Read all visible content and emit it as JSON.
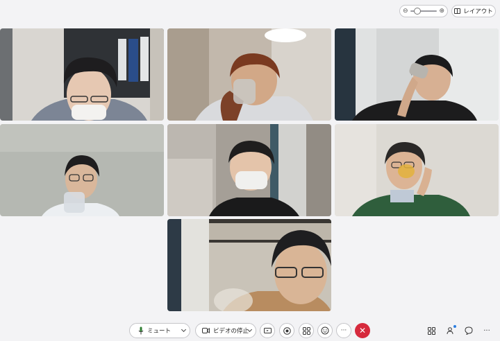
{
  "header": {
    "zoom_minus_icon": "zoom-out-icon",
    "zoom_plus_icon": "zoom-in-icon",
    "zoom_level": 0.2,
    "layout_label": "レイアウト"
  },
  "controls": {
    "mute_label": "ミュート",
    "video_stop_label": "ビデオの停止",
    "more_label": "···",
    "end_icon": "✕"
  },
  "colors": {
    "end_call": "#d62a3d",
    "notification_dot": "#2a7de1"
  },
  "participants": [
    {
      "id": "p1",
      "action": "wearing-mask"
    },
    {
      "id": "p2",
      "action": "drinking"
    },
    {
      "id": "p3",
      "action": "drinking"
    },
    {
      "id": "p4",
      "action": "drinking"
    },
    {
      "id": "p5",
      "action": "wearing-mask"
    },
    {
      "id": "p6",
      "action": "drinking"
    },
    {
      "id": "p7",
      "action": "looking-at-camera"
    }
  ]
}
